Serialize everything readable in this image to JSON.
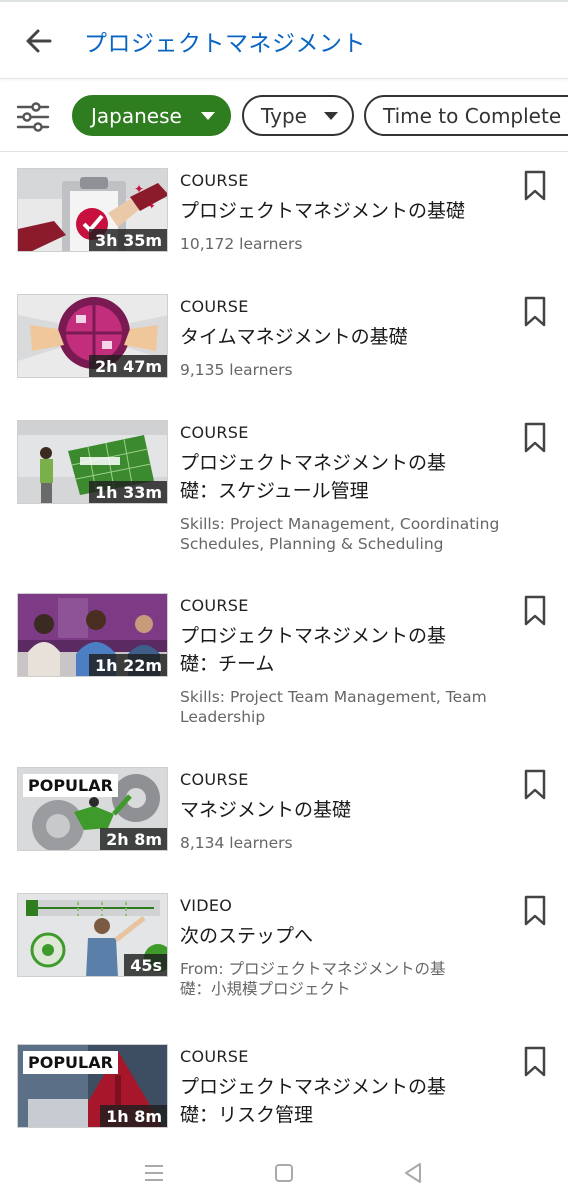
{
  "header": {
    "title": "プロジェクトマネジメント"
  },
  "filters": {
    "language": "Japanese",
    "type": "Type",
    "time": "Time to Complete"
  },
  "items": [
    {
      "type": "COURSE",
      "title": "プロジェクトマネジメントの基礎",
      "duration": "3h 35m",
      "meta": "10,172 learners",
      "badge": ""
    },
    {
      "type": "COURSE",
      "title": "タイムマネジメントの基礎",
      "duration": "2h 47m",
      "meta": "9,135 learners",
      "badge": ""
    },
    {
      "type": "COURSE",
      "title_line1": "プロジェクトマネジメントの基",
      "title_line2": "礎：スケジュール管理",
      "duration": "1h 33m",
      "meta": "Skills: Project Management, Coordinating Schedules, Planning & Scheduling",
      "badge": ""
    },
    {
      "type": "COURSE",
      "title_line1": "プロジェクトマネジメントの基",
      "title_line2": "礎：チーム",
      "duration": "1h 22m",
      "meta": "Skills: Project Team Management, Team Leadership",
      "badge": ""
    },
    {
      "type": "COURSE",
      "title": "マネジメントの基礎",
      "duration": "2h 8m",
      "meta": "8,134 learners",
      "badge": "POPULAR"
    },
    {
      "type": "VIDEO",
      "title": "次のステップへ",
      "duration": "45s",
      "meta_line1": "From: プロジェクトマネジメントの基",
      "meta_line2": "礎：小規模プロジェクト",
      "badge": ""
    },
    {
      "type": "COURSE",
      "title_line1": "プロジェクトマネジメントの基",
      "title_line2": "礎：リスク管理",
      "duration": "1h 8m",
      "meta": "",
      "badge": "POPULAR"
    }
  ],
  "colors": {
    "accent": "#0a66c2",
    "chip_selected": "#2e7d1f"
  },
  "icons": [
    "back-arrow-icon",
    "filter-sliders-icon",
    "bookmark-icon",
    "menu-icon",
    "home-square-icon",
    "back-triangle-icon"
  ]
}
